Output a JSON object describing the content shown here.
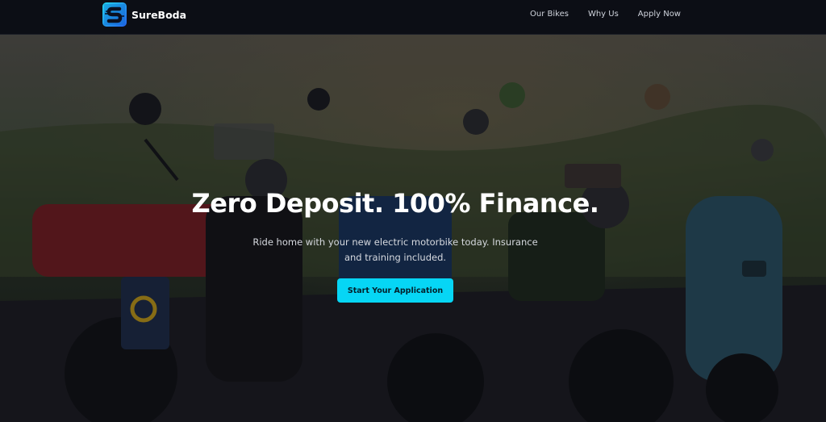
{
  "brand": {
    "name": "SureBoda",
    "logo_letter": "S",
    "logo_colors": [
      "#22d3ee",
      "#2563eb"
    ]
  },
  "nav": {
    "items": [
      {
        "label": "Our Bikes"
      },
      {
        "label": "Why Us"
      },
      {
        "label": "Apply Now"
      }
    ]
  },
  "hero": {
    "background": "dark-overlay photo of lined-up electric motorbikes",
    "headline": "Zero Deposit. 100% Finance.",
    "subtext": "Ride home with your new electric motorbike today. Insurance and training included.",
    "cta_label": "Start Your Application",
    "accent": "#06d6f5"
  }
}
